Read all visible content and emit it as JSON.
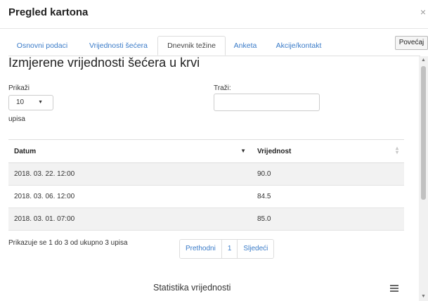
{
  "modal": {
    "title": "Pregled kartona",
    "close_glyph": "×"
  },
  "tabs": [
    {
      "label": "Osnovni podaci"
    },
    {
      "label": "Vrijednosti šećera"
    },
    {
      "label": "Dnevnik težine",
      "active": true
    },
    {
      "label": "Anketa"
    },
    {
      "label": "Akcije/kontakt"
    }
  ],
  "expand_button": {
    "label": "Povećaj"
  },
  "section": {
    "title": "Izmjerene vrijednosti šećera u krvi"
  },
  "controls": {
    "show_label": "Prikaži",
    "show_value": "10",
    "entries_label": "upisa",
    "search_label": "Traži:",
    "search_value": ""
  },
  "table": {
    "headers": [
      "Datum",
      "Vrijednost"
    ],
    "rows": [
      [
        "2018. 03. 22. 12:00",
        "90.0"
      ],
      [
        "2018. 03. 06. 12:00",
        "84.5"
      ],
      [
        "2018. 03. 01. 07:00",
        "85.0"
      ]
    ]
  },
  "footer": {
    "info": "Prikazuje se 1 do 3 od ukupno 3 upisa",
    "prev": "Prethodni",
    "page": "1",
    "next": "Sljedeći"
  },
  "stats": {
    "title": "Statistika vrijednosti"
  },
  "icons": {
    "sort_desc": "sort-descending-icon",
    "sort_both": "sort-both-icon",
    "menu": "hamburger-menu-icon",
    "caret": "caret-down-icon"
  }
}
